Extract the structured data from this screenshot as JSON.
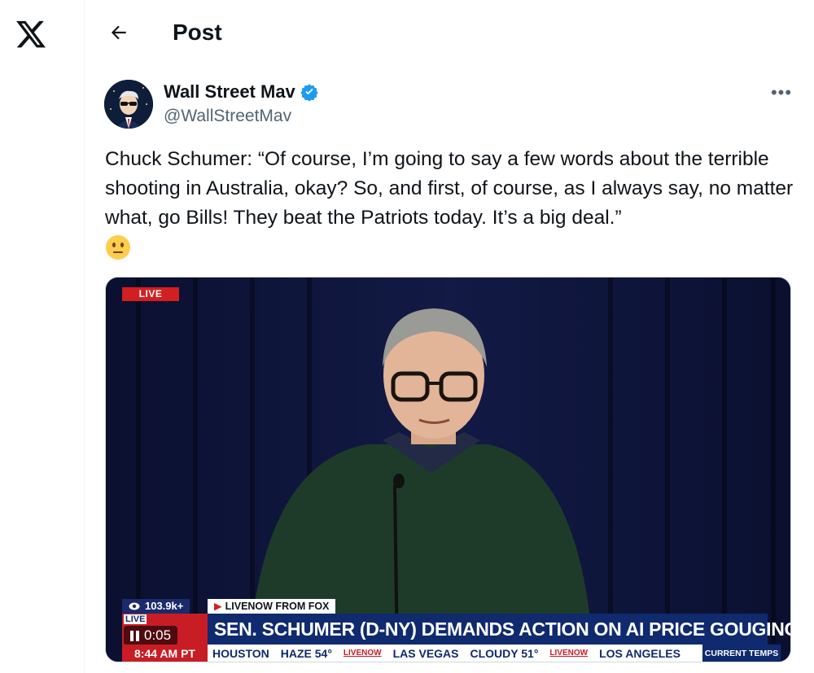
{
  "app": {
    "logo": "x-logo-icon"
  },
  "header": {
    "back_icon": "arrow-left-icon",
    "title": "Post"
  },
  "post": {
    "author": {
      "name": "Wall Street Mav",
      "handle": "@WallStreetMav",
      "verified": true,
      "verified_color": "#1d9bf0"
    },
    "more_icon": "more-horizontal-icon",
    "more_label": "•••",
    "text": "Chuck Schumer: “Of course, I’m going to say a few words about the terrible shooting in Australia, okay? So, and first, of course, as I always say, no matter what, go Bills! They beat the Patriots today. It’s a big deal.”",
    "emoji": "neutral-face-emoji"
  },
  "video": {
    "live_badge": "LIVE",
    "views": "103.9k+",
    "source": "LIVENOW FROM FOX",
    "headline": "SEN. SCHUMER (D-NY) DEMANDS ACTION ON AI PRICE GOUGING",
    "live_now_label": "LIVE",
    "timer": "0:05",
    "clock": "8:44 AM PT",
    "ticker": [
      {
        "city": "HOUSTON",
        "cond": "HAZE 54°"
      },
      {
        "city": "LAS VEGAS",
        "cond": "CLOUDY 51°"
      },
      {
        "city": "LOS ANGELES",
        "cond": ""
      }
    ],
    "ticker_sep": "LIVENOW",
    "temps_label": "CURRENT TEMPS"
  }
}
